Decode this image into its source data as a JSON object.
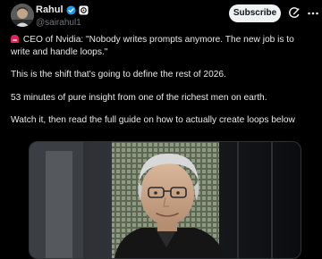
{
  "post": {
    "author": {
      "display_name": "Rahul",
      "handle": "@sairahul1",
      "verified_icon": "verified-badge-icon",
      "extra_badge_icon": "gear-icon"
    },
    "subscribe_label": "Subscribe",
    "actions": {
      "grok_icon": "grok-icon",
      "more_icon": "more-options-icon"
    },
    "paragraphs": [
      "CEO of Nvidia: \"Nobody writes prompts anymore. The new job is to\nwrite and handle loops.\"",
      "This is the shift that's going to define the rest of 2026.",
      "53 minutes of pure insight from one of the richest men on earth.",
      "Watch it, then read the full guide on how to actually create loops below"
    ],
    "lead_icon": "siren-icon",
    "media": {
      "type": "video-thumbnail"
    }
  },
  "colors": {
    "background": "#000000",
    "text": "#e7e9ea",
    "secondary_text": "#71767b",
    "verified": "#1d9bf0",
    "button_bg": "#eff3f4"
  }
}
